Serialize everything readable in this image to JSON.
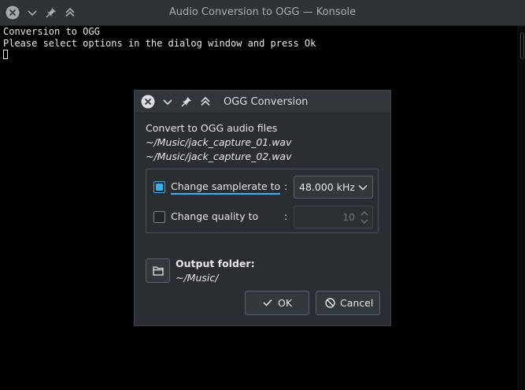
{
  "window": {
    "title": "Audio Conversion to OGG — Konsole"
  },
  "terminal": {
    "lines": [
      "Conversion to OGG",
      "Please select options in the dialog window and press Ok"
    ]
  },
  "dialog": {
    "title": "OGG Conversion",
    "heading": "Convert to OGG audio files",
    "files": [
      "~/Music/jack_capture_01.wav",
      "~/Music/jack_capture_02.wav"
    ],
    "samplerate": {
      "label": "Change samplerate to",
      "checked": true,
      "separator": ":",
      "value": "48.000 kHz"
    },
    "quality": {
      "label": "Change quality to",
      "checked": false,
      "separator": ":",
      "value": "10"
    },
    "output": {
      "label": "Output folder:",
      "path": "~/Music/"
    },
    "ok_label": "OK",
    "cancel_label": "Cancel"
  },
  "colors": {
    "accent": "#3daee9",
    "dialog_bg": "#2a2e32",
    "titlebar_bg": "#2f3338"
  },
  "icons": [
    "close-icon",
    "chevron-down-icon",
    "pin-icon",
    "keep-above-icon",
    "folder-icon",
    "checkmark-icon",
    "cancel-icon",
    "spin-arrows-icon"
  ]
}
